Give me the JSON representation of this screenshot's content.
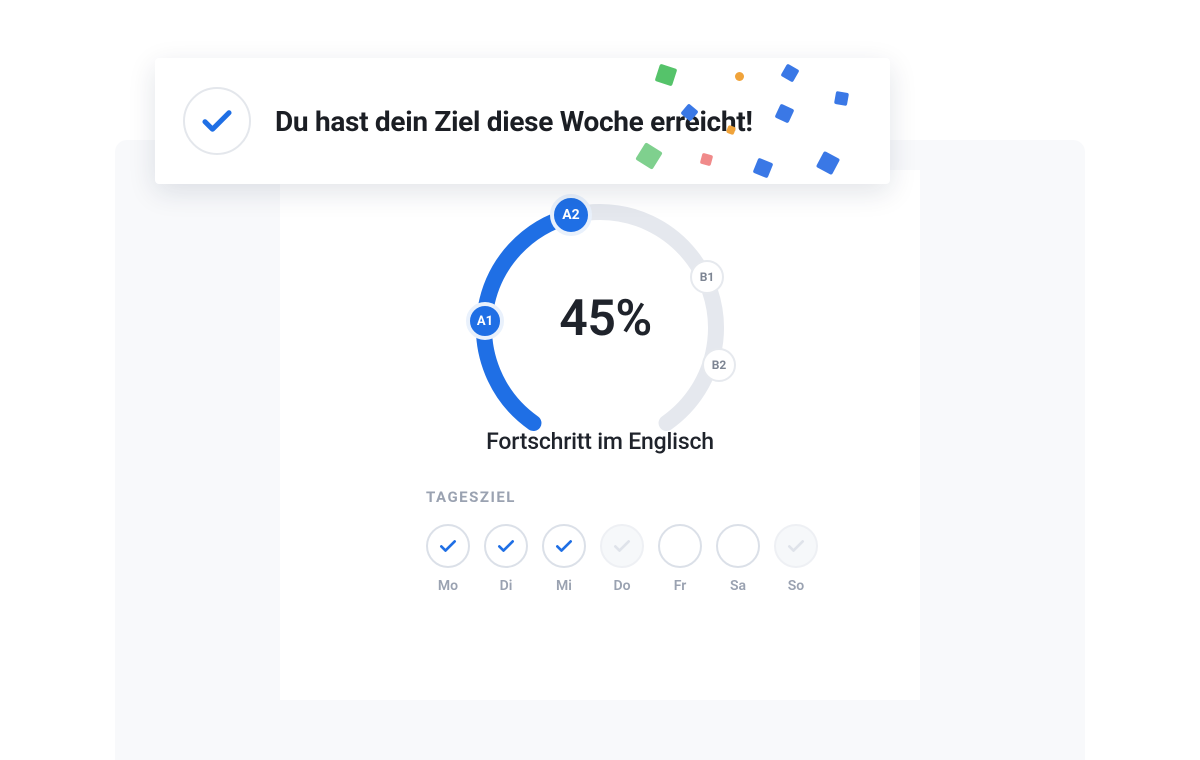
{
  "toast": {
    "message": "Du hast dein Ziel diese Woche erreicht!"
  },
  "progress": {
    "percent_label": "45%",
    "subtitle": "Fortschritt im Englisch",
    "levels": {
      "a1": "A1",
      "a2": "A2",
      "b1": "B1",
      "b2": "B2"
    }
  },
  "daily": {
    "section_label": "TAGESZIEL",
    "days": [
      {
        "label": "Mo",
        "state": "done"
      },
      {
        "label": "Di",
        "state": "done"
      },
      {
        "label": "Mi",
        "state": "done"
      },
      {
        "label": "Do",
        "state": "dim"
      },
      {
        "label": "Fr",
        "state": "empty"
      },
      {
        "label": "Sa",
        "state": "empty"
      },
      {
        "label": "So",
        "state": "dim"
      }
    ]
  },
  "colors": {
    "accent": "#1f6fe5",
    "track": "#e5e8ee"
  },
  "chart_data": {
    "type": "pie",
    "title": "Fortschritt im Englisch",
    "value": 45,
    "max": 100,
    "categories": [
      "A1",
      "A2",
      "B1",
      "B2"
    ],
    "current_segment": "A2"
  }
}
